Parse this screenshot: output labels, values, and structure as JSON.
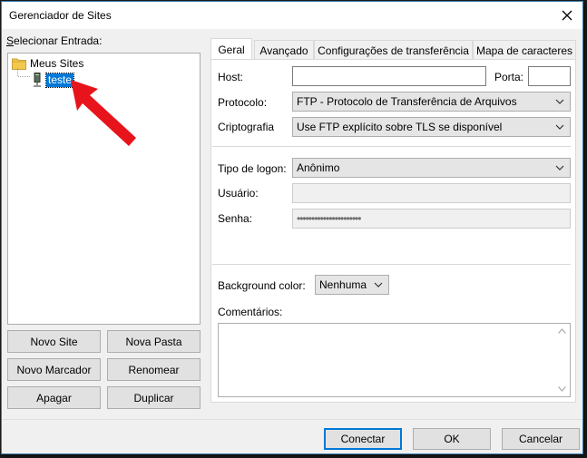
{
  "window": {
    "title": "Gerenciador de Sites"
  },
  "left": {
    "select_label": "Selecionar Entrada:",
    "tree": {
      "root": "Meus Sites",
      "child": "teste"
    },
    "buttons": {
      "new_site": "Novo Site",
      "new_folder": "Nova Pasta",
      "new_bookmark": "Novo Marcador",
      "rename": "Renomear",
      "delete": "Apagar",
      "duplicate": "Duplicar"
    }
  },
  "tabs": [
    "Geral",
    "Avançado",
    "Configurações de transferência",
    "Mapa de caracteres"
  ],
  "general": {
    "host_label": "Host:",
    "host_value": "",
    "port_label": "Porta:",
    "port_value": "",
    "protocol_label": "Protocolo:",
    "protocol_value": "FTP - Protocolo de Transferência de Arquivos",
    "encryption_label": "Criptografia",
    "encryption_value": "Use FTP explícito sobre TLS se disponível",
    "logon_label": "Tipo de logon:",
    "logon_value": "Anônimo",
    "user_label": "Usuário:",
    "user_value": "",
    "password_label": "Senha:",
    "password_value": "••••••••••••••••••••••",
    "bgcolor_label": "Background color:",
    "bgcolor_value": "Nenhuma",
    "comments_label": "Comentários:",
    "comments_value": ""
  },
  "footer": {
    "connect": "Conectar",
    "ok": "OK",
    "cancel": "Cancelar"
  },
  "colors": {
    "accent": "#0078d7",
    "annotation_arrow": "#e8141b"
  }
}
